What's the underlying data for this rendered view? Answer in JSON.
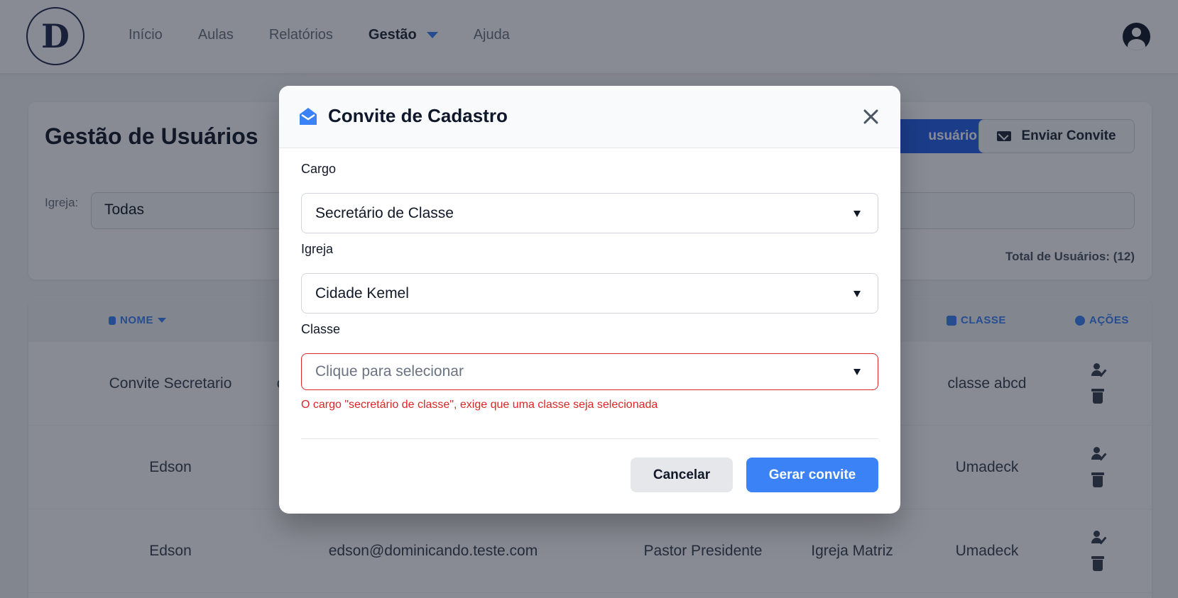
{
  "nav": {
    "logo_text": "D",
    "items": [
      {
        "label": "Início"
      },
      {
        "label": "Aulas"
      },
      {
        "label": "Relatórios"
      },
      {
        "label": "Gestão"
      },
      {
        "label": "Ajuda"
      }
    ]
  },
  "header": {
    "title": "Gestão de Usuários",
    "new_user_label": "usuário",
    "send_invite_label": "Enviar Convite",
    "filter_label": "Igreja:",
    "filter_value": "Todas",
    "total_label": "Total de Usuários: (12)"
  },
  "table": {
    "headers": {
      "name": "NOME",
      "class": "CLASSE",
      "actions": "AÇÕES"
    },
    "rows": [
      {
        "name": "Convite Secretario",
        "email": "c",
        "role": "",
        "church": "",
        "class": "classe abcd"
      },
      {
        "name": "Edson",
        "email": "",
        "role": "",
        "church": "",
        "class": "Umadeck"
      },
      {
        "name": "Edson",
        "email": "edson@dominicando.teste.com",
        "role": "Pastor Presidente",
        "church": "Igreja Matriz",
        "class": "Umadeck"
      }
    ]
  },
  "modal": {
    "title": "Convite de Cadastro",
    "cargo_label": "Cargo",
    "cargo_value": "Secretário de Classe",
    "igreja_label": "Igreja",
    "igreja_value": "Cidade Kemel",
    "classe_label": "Classe",
    "classe_placeholder": "Clique para selecionar",
    "error": "O cargo \"secretário de classe\", exige que uma classe seja selecionada",
    "cancel_label": "Cancelar",
    "generate_label": "Gerar convite"
  },
  "colors": {
    "accent": "#3b82f6",
    "error": "#dc2626",
    "overlay": "rgba(17,24,39,0.5)"
  }
}
